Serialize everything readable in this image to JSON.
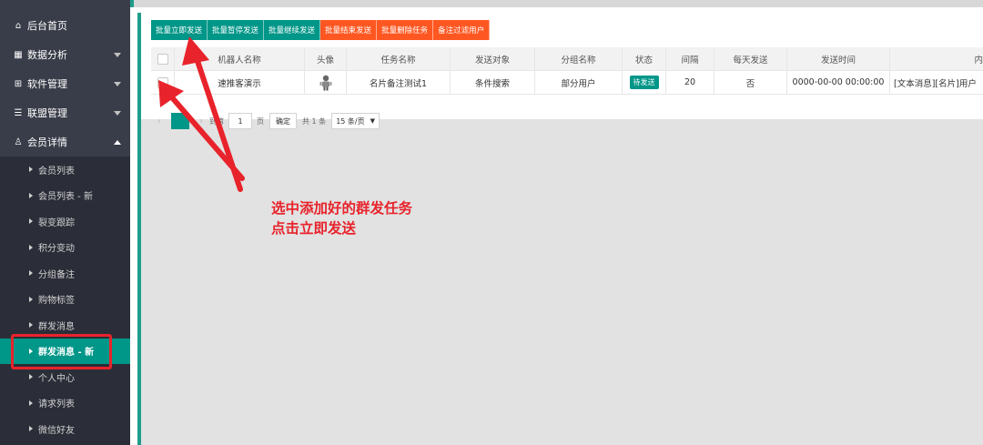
{
  "sidebar": {
    "top_items": [
      {
        "label": "后台首页",
        "icon": "home-icon",
        "caret": ""
      },
      {
        "label": "数据分析",
        "icon": "chart-icon",
        "caret": "down"
      },
      {
        "label": "软件管理",
        "icon": "grid-icon",
        "caret": "down"
      },
      {
        "label": "联盟管理",
        "icon": "list-icon",
        "caret": "down"
      },
      {
        "label": "会员详情",
        "icon": "user-icon",
        "caret": "up"
      }
    ],
    "sub_items": [
      {
        "label": "会员列表"
      },
      {
        "label": "会员列表 - 新"
      },
      {
        "label": "裂变跟踪"
      },
      {
        "label": "积分变动"
      },
      {
        "label": "分组备注"
      },
      {
        "label": "购物标签"
      },
      {
        "label": "群发消息"
      },
      {
        "label": "群发消息 - 新",
        "active": true
      },
      {
        "label": "个人中心"
      },
      {
        "label": "请求列表"
      },
      {
        "label": "微信好友"
      }
    ]
  },
  "toolbar": {
    "buttons": [
      {
        "label": "批量立即发送",
        "color": "#009688"
      },
      {
        "label": "批量暂停发送",
        "color": "#009688"
      },
      {
        "label": "批量继续发送",
        "color": "#009688"
      },
      {
        "label": "批量结束发送",
        "color": "#ff5722"
      },
      {
        "label": "批量删除任务",
        "color": "#ff5722"
      },
      {
        "label": "备注过滤用户",
        "color": "#ff5722"
      }
    ]
  },
  "table": {
    "headers": [
      "",
      "机器人名称",
      "头像",
      "任务名称",
      "发送对象",
      "分组名称",
      "状态",
      "间隔",
      "每天发送",
      "发送时间",
      "内"
    ],
    "rows": [
      {
        "robot_name": "速推客演示",
        "avatar_icon": "robot-avatar-icon",
        "task_name": "名片备注测试1",
        "target": "条件搜索",
        "group_name": "部分用户",
        "status": "待发送",
        "interval": "20",
        "daily": "否",
        "send_time": "0000-00-00 00:00:00",
        "content": "[文本消息][名片]用户"
      }
    ]
  },
  "pager": {
    "goto_label": "到第",
    "page_value": "1",
    "page_suffix": "页",
    "confirm_label": "确定",
    "total": "共 1 条",
    "page_size": "15 条/页"
  },
  "annotation": {
    "line1": "选中添加好的群发任务",
    "line2": "点击立即发送",
    "color": "#e8232b"
  },
  "colors": {
    "accent": "#009688",
    "danger": "#ff5722",
    "sidebar": "#393d49"
  }
}
